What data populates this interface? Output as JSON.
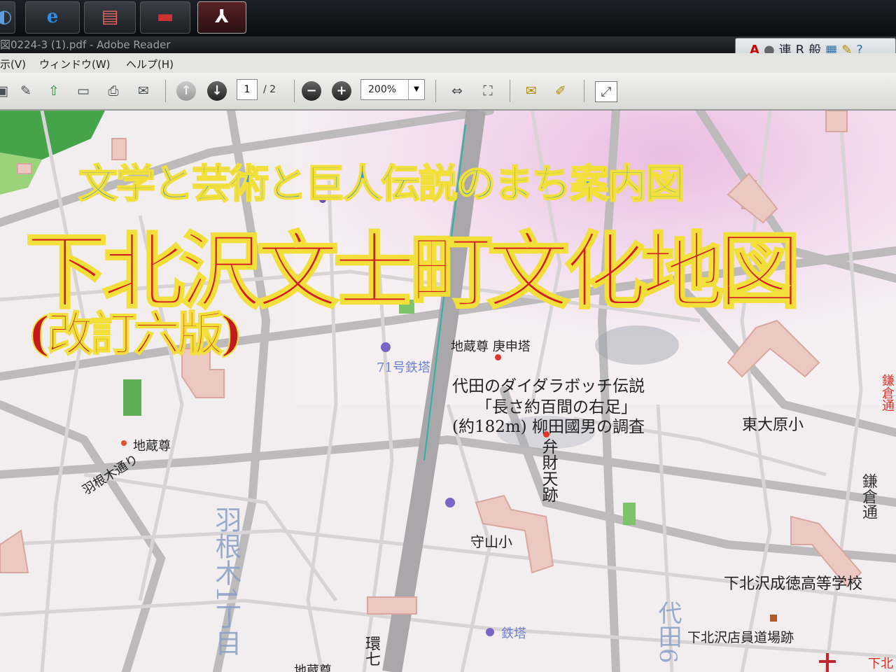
{
  "window": {
    "title": "図0224-3 (1).pdf - Adobe Reader"
  },
  "taskbar": {
    "apps": [
      {
        "icon": "windows-explorer-icon"
      },
      {
        "icon": "internet-explorer-icon",
        "glyph": "e"
      },
      {
        "icon": "window-switcher-icon"
      },
      {
        "icon": "media-app-icon"
      },
      {
        "icon": "adobe-reader-icon",
        "active": true
      }
    ]
  },
  "language_bar": {
    "items": [
      "連",
      "R",
      "般"
    ]
  },
  "menu": {
    "items": [
      "示(V)",
      "ウィンドウ(W)",
      "ヘルプ(H)"
    ]
  },
  "toolbar": {
    "page_current": "1",
    "page_total": "/ 2",
    "zoom": "200%"
  },
  "map": {
    "subtitle": "文学と芸術と巨人伝説のまち案内図",
    "title": "下北沢文士町文化地図",
    "edition": "(改訂六版)",
    "labels": {
      "jizo_koshin": "地蔵尊 庚申塔",
      "tower71": "71号鉄塔",
      "legend_line1": "代田のダイダラボッチ伝説",
      "legend_line2": "「長さ約百間の右足」",
      "legend_line3": "(約182m) 柳田國男の調査",
      "higashi_ohara": "東大原小",
      "jizo_left": "地蔵尊",
      "hanegi_street": "羽根木通り",
      "benzaiten": "弁財天跡",
      "moriyama": "守山小",
      "seitoku": "下北沢成徳高等学校",
      "tower": "鉄塔",
      "tenin": "下北沢店員道場跡",
      "jizo_bottom": "地蔵尊",
      "kamakura_top": "鎌倉通",
      "kamakura": "鎌倉通",
      "hanegi_block": "羽根木1丁目",
      "daita": "代田6",
      "kan7": "環七",
      "shimokita_edge": "下北"
    },
    "colors": {
      "title_red": "#d41c22",
      "subtitle_blue": "#3f9ad0",
      "outline_yellow": "#f2df3a",
      "poi_red": "#e0352a",
      "poi_purple": "#7b64c8"
    }
  }
}
